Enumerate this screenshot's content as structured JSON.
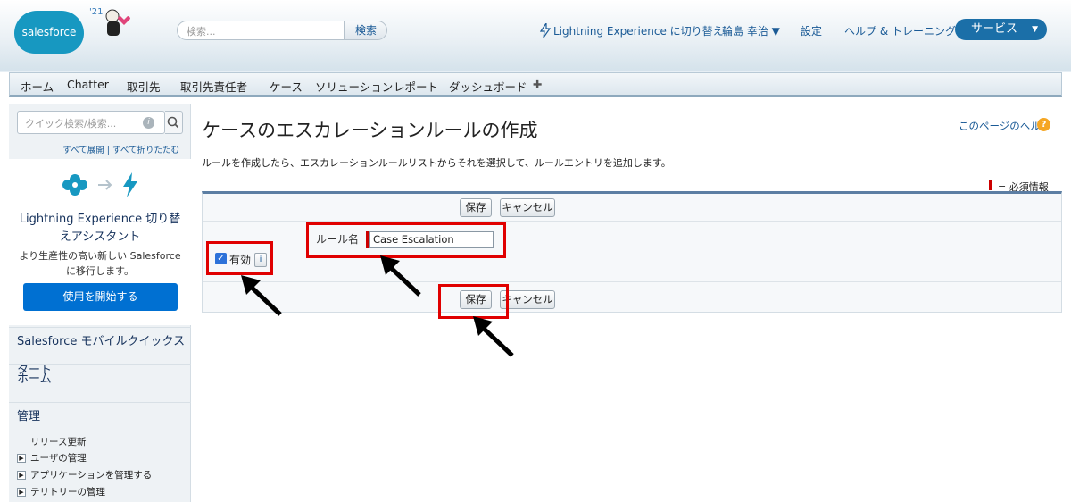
{
  "header": {
    "logo_text": "salesforce",
    "release_badge": "'21",
    "search_placeholder": "検索...",
    "search_button": "検索",
    "links": [
      {
        "label": "Lightning Experience に切り替え"
      },
      {
        "label": "輪島 幸治 ▼"
      },
      {
        "label": "設定"
      },
      {
        "label": "ヘルプ & トレーニング"
      }
    ],
    "app_menu": "サービス"
  },
  "tabs": [
    "ホーム",
    "Chatter",
    "取引先",
    "取引先責任者",
    "ケース",
    "ソリューション",
    "レポート",
    "ダッシュボード",
    "✚"
  ],
  "sidebar": {
    "quick_search_placeholder": "クイック検索/検索...",
    "expand_all": "すべて展開",
    "collapse_all": "すべて折りたたむ",
    "link_separator": "|",
    "lightning_title": "Lightning Experience 切り替えアシスタント",
    "lightning_desc": "より生産性の高い新しい Salesforce に移行します。",
    "lightning_button": "使用を開始する",
    "sections": [
      {
        "label": "Salesforce モバイルクイックスタート"
      },
      {
        "label": "ホーム"
      },
      {
        "label": "管理"
      }
    ],
    "admin_items": [
      {
        "label": "リリース更新",
        "expandable": false
      },
      {
        "label": "ユーザの管理",
        "expandable": true
      },
      {
        "label": "アプリケーションを管理する",
        "expandable": true
      },
      {
        "label": "テリトリーの管理",
        "expandable": true
      }
    ]
  },
  "main": {
    "title": "ケースのエスカレーションルールの作成",
    "help_link": "このページのヘルプ",
    "description": "ルールを作成したら、エスカレーションルールリストからそれを選択して、ルールエントリを追加します。",
    "required_legend": "= 必須情報",
    "save_label": "保存",
    "cancel_label": "キャンセル",
    "rule_name_label": "ルール名",
    "rule_name_value": "Case Escalation",
    "active_label": "有効",
    "active_checked": true,
    "info_icon": "i"
  },
  "colors": {
    "brand_blue": "#1798c1",
    "service_button": "#1b6fa8",
    "primary_button": "#0070d2",
    "highlight_red": "#e00000",
    "required_red": "#cc0000"
  }
}
